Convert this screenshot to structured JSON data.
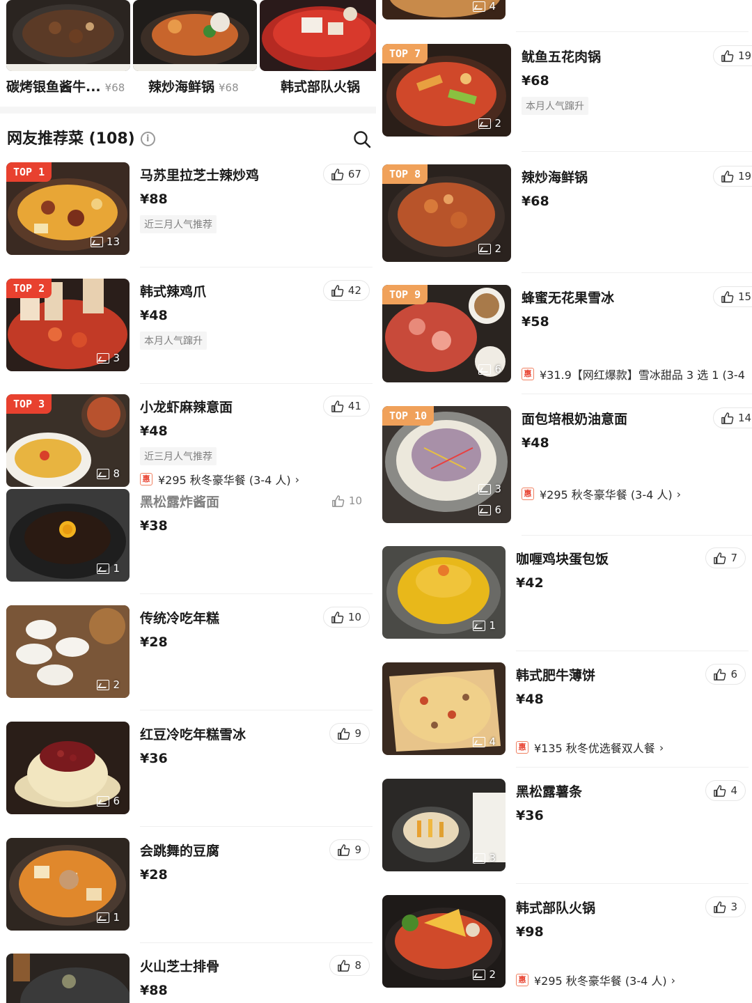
{
  "top_strip": [
    {
      "name": "碳烤银鱼酱牛...",
      "price": "¥68"
    },
    {
      "name": "辣炒海鲜锅",
      "price": "¥68"
    },
    {
      "name": "韩式部队火锅",
      "price": ""
    }
  ],
  "section": {
    "title": "网友推荐菜 (108)",
    "info_symbol": "i"
  },
  "left_items": [
    {
      "rank": "TOP 1",
      "name": "马苏里拉芝士辣炒鸡",
      "price": "¥88",
      "likes": "67",
      "images": "13",
      "tag": "近三月人气推荐",
      "promo": ""
    },
    {
      "rank": "TOP 2",
      "name": "韩式辣鸡爪",
      "price": "¥48",
      "likes": "42",
      "images": "3",
      "tag": "本月人气蹿升",
      "promo": ""
    },
    {
      "rank": "TOP 3",
      "name": "小龙虾麻辣意面",
      "price": "¥48",
      "likes": "41",
      "images": "8",
      "tag": "近三月人气推荐",
      "promo": "¥295 秋冬豪华餐 (3-4 人)"
    },
    {
      "rank": "",
      "name": "黑松露炸酱面",
      "price": "¥38",
      "likes": "10",
      "images": "1",
      "tag": "",
      "promo": ""
    },
    {
      "rank": "",
      "name": "传统冷吃年糕",
      "price": "¥28",
      "likes": "10",
      "images": "2",
      "tag": "",
      "promo": ""
    },
    {
      "rank": "",
      "name": "红豆冷吃年糕雪冰",
      "price": "¥36",
      "likes": "9",
      "images": "6",
      "tag": "",
      "promo": ""
    },
    {
      "rank": "",
      "name": "会跳舞的豆腐",
      "price": "¥28",
      "likes": "9",
      "images": "1",
      "tag": "",
      "promo": ""
    },
    {
      "rank": "",
      "name": "火山芝士排骨",
      "price": "¥88",
      "likes": "8",
      "images": "",
      "tag": "",
      "promo": ""
    }
  ],
  "right_items": [
    {
      "rank": "",
      "name": "",
      "price": "",
      "likes": "",
      "images": "4",
      "tag": "",
      "promo": ""
    },
    {
      "rank": "TOP 7",
      "name": "鱿鱼五花肉锅",
      "price": "¥68",
      "likes": "19",
      "images": "2",
      "tag": "本月人气蹿升",
      "promo": ""
    },
    {
      "rank": "TOP 8",
      "name": "辣炒海鲜锅",
      "price": "¥68",
      "likes": "19",
      "images": "2",
      "tag": "",
      "promo": ""
    },
    {
      "rank": "TOP 9",
      "name": "蜂蜜无花果雪冰",
      "price": "¥58",
      "likes": "15",
      "images": "6",
      "tag": "",
      "promo": "¥31.9【网红爆款】雪冰甜品 3 选 1 (3-4"
    },
    {
      "rank": "TOP 10",
      "name": "面包培根奶油意面",
      "price": "¥48",
      "likes": "14",
      "images": "3",
      "images2": "6",
      "tag": "",
      "promo": "¥295 秋冬豪华餐 (3-4 人)"
    },
    {
      "rank": "",
      "name": "咖喱鸡块蛋包饭",
      "price": "¥42",
      "likes": "7",
      "images": "1",
      "tag": "",
      "promo": ""
    },
    {
      "rank": "",
      "name": "韩式肥牛薄饼",
      "price": "¥48",
      "likes": "6",
      "images": "4",
      "tag": "",
      "promo": "¥135 秋冬优选餐双人餐"
    },
    {
      "rank": "",
      "name": "黑松露薯条",
      "price": "¥36",
      "likes": "4",
      "images": "3",
      "tag": "",
      "promo": ""
    },
    {
      "rank": "",
      "name": "韩式部队火锅",
      "price": "¥98",
      "likes": "3",
      "images": "2",
      "tag": "",
      "promo": "¥295 秋冬豪华餐 (3-4 人)"
    }
  ],
  "promo_icon_label": "惠",
  "chevron": "›",
  "colors": {
    "badge_red": "#e8412f",
    "badge_orange": "#f0a15a",
    "divider": "#efefef",
    "tag_bg": "#f5f5f5"
  }
}
